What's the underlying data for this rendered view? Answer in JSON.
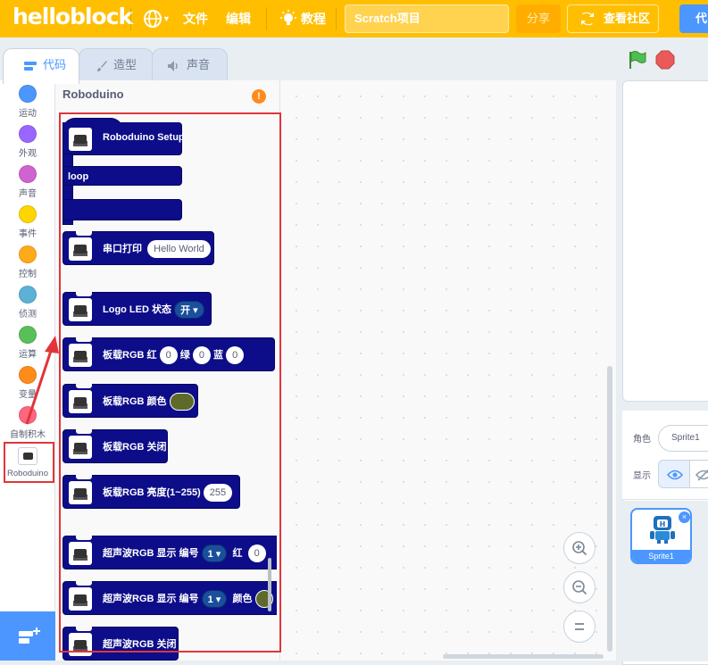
{
  "menubar": {
    "logo": "helloblock",
    "file": "文件",
    "edit": "编辑",
    "tutorials": "教程",
    "project_title": "Scratch项目",
    "share": "分享",
    "community": "查看社区",
    "code_right": "代"
  },
  "tabs": [
    {
      "label": "代码",
      "icon": "code-icon"
    },
    {
      "label": "造型",
      "icon": "brush-icon"
    },
    {
      "label": "声音",
      "icon": "speaker-icon"
    }
  ],
  "categories": [
    {
      "label": "运动",
      "color": "#4c97ff"
    },
    {
      "label": "外观",
      "color": "#9966ff"
    },
    {
      "label": "声音",
      "color": "#cf63cf"
    },
    {
      "label": "事件",
      "color": "#ffd500"
    },
    {
      "label": "控制",
      "color": "#ffab19"
    },
    {
      "label": "侦测",
      "color": "#5cb1d6"
    },
    {
      "label": "运算",
      "color": "#59c059"
    },
    {
      "label": "变量",
      "color": "#ff8c1a"
    },
    {
      "label": "自制积木",
      "color": "#ff6680"
    },
    {
      "label": "Roboduino",
      "color": "#0d0d8a"
    }
  ],
  "flyout": {
    "title": "Roboduino",
    "blocks": {
      "setup": "Roboduino Setup",
      "loop": "loop",
      "serial_print": "串口打印",
      "serial_value": "Hello World",
      "logo_led": "Logo LED 状态",
      "logo_led_value": "开",
      "rgb": "板载RGB 红",
      "rgb_red": "0",
      "rgb_green_label": "绿",
      "rgb_green": "0",
      "rgb_blue_label": "蓝",
      "rgb_blue": "0",
      "rgb_color": "板载RGB 颜色",
      "rgb_off": "板载RGB 关闭",
      "rgb_brightness": "板载RGB  亮度(1~255)",
      "rgb_brightness_value": "255",
      "us_rgb": "超声波RGB 显示 编号",
      "us_rgb_num": "1",
      "us_rgb_red_label": "红",
      "us_rgb_red": "0",
      "us_rgb_color_label": "颜色",
      "us_rgb_off": "超声波RGB 关闭"
    }
  },
  "sprite_info": {
    "sprite_label": "角色",
    "sprite_name": "Sprite1",
    "show_label": "显示"
  },
  "sprites": [
    {
      "name": "Sprite1"
    }
  ],
  "colors": {
    "menubar": "#ffbf00",
    "block": "#0d0d8a",
    "highlight": "#e0363b"
  }
}
